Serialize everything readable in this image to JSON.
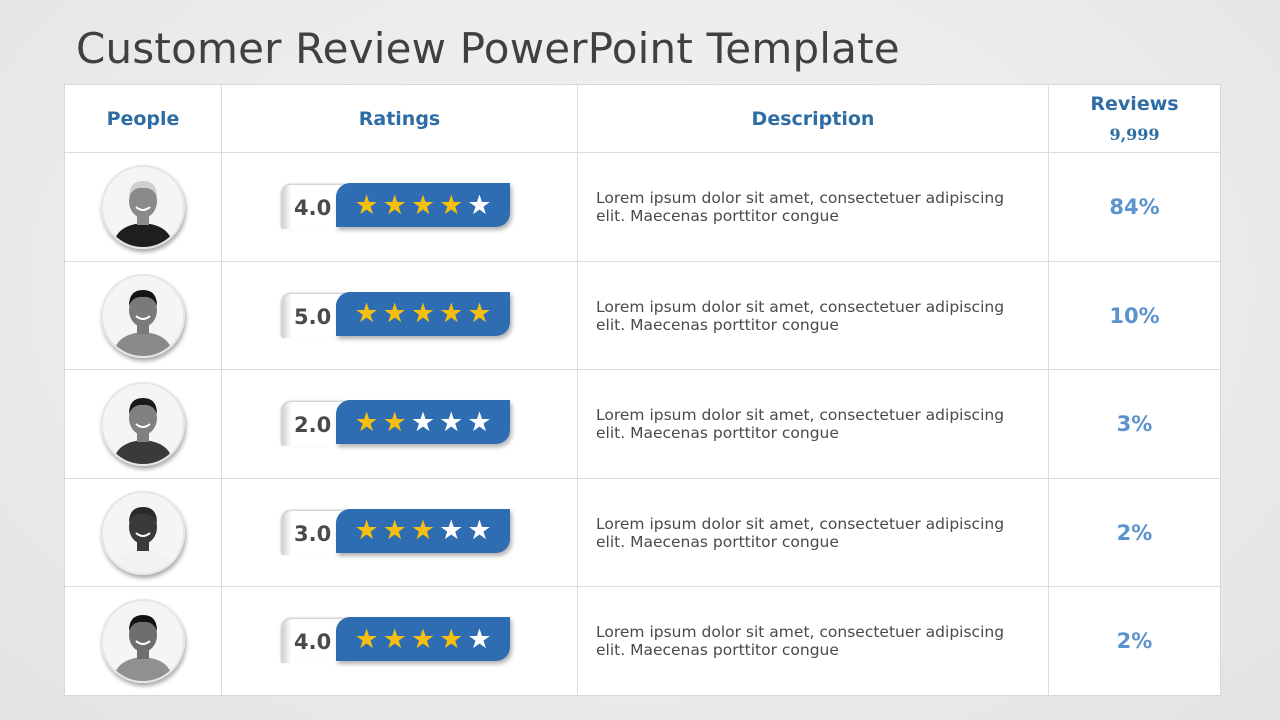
{
  "title": "Customer Review PowerPoint Template",
  "colors": {
    "accent": "#2e6db1",
    "header_text": "#2e6da4",
    "star_on": "#f6bf10",
    "star_off": "#ffffff",
    "percent": "#5b93cc"
  },
  "table": {
    "headers": {
      "people": "People",
      "ratings": "Ratings",
      "description": "Description",
      "reviews": "Reviews",
      "reviews_count": "9,999"
    },
    "rows": [
      {
        "person": "avatar-older-man-glasses",
        "rating": "4.0",
        "stars": 4,
        "description": "Lorem ipsum dolor sit amet, consectetuer adipiscing elit. Maecenas porttitor congue",
        "percent": "84%"
      },
      {
        "person": "avatar-young-man",
        "rating": "5.0",
        "stars": 5,
        "description": "Lorem ipsum dolor sit amet, consectetuer adipiscing elit. Maecenas porttitor congue",
        "percent": "10%"
      },
      {
        "person": "avatar-man-goatee",
        "rating": "2.0",
        "stars": 2,
        "description": "Lorem ipsum dolor sit amet, consectetuer adipiscing elit. Maecenas porttitor congue",
        "percent": "3%"
      },
      {
        "person": "avatar-smiling-man",
        "rating": "3.0",
        "stars": 3,
        "description": "Lorem ipsum dolor sit amet, consectetuer adipiscing elit. Maecenas porttitor congue",
        "percent": "2%"
      },
      {
        "person": "avatar-young-man-polo",
        "rating": "4.0",
        "stars": 4,
        "description": "Lorem ipsum dolor sit amet, consectetuer adipiscing elit. Maecenas porttitor congue",
        "percent": "2%"
      }
    ]
  },
  "icons": {
    "star": "★"
  }
}
